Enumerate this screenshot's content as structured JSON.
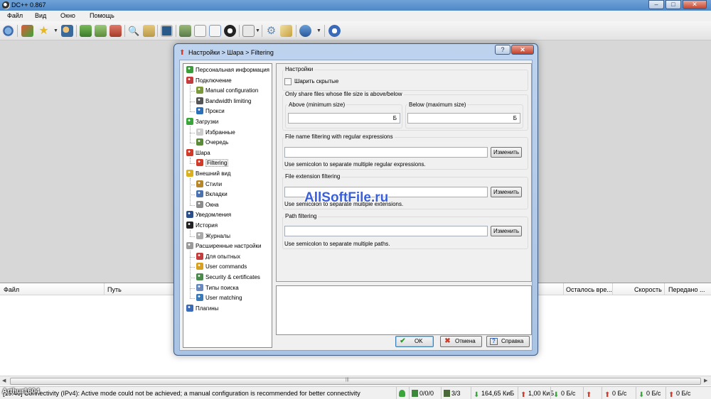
{
  "window": {
    "title": "DC++ 0.867",
    "controls": {
      "minimize": "–",
      "maximize": "□",
      "close": "✕"
    }
  },
  "menu": [
    "Файл",
    "Вид",
    "Окно",
    "Помощь"
  ],
  "toolbar": {
    "icons": [
      "connect-icon",
      "reconnect-icon",
      "favorites-icon",
      "favorite-users-icon",
      "download-queue-icon",
      "finished-downloads-icon",
      "upload-queue-icon",
      "search-icon",
      "adl-search-icon",
      "search-spy-icon",
      "open-filelist-icon",
      "notepad-icon",
      "network-stats-icon",
      "settings-icon",
      "plugins-icon",
      "refresh-share-icon",
      "help-icon"
    ]
  },
  "transfers": {
    "columns": [
      "Файл",
      "Путь",
      "Осталось вре...",
      "Скорость",
      "Передано ..."
    ]
  },
  "statusbar": {
    "message": "[19:46] Connectivity (IPv4): Active mode could not be achieved; a manual configuration is recommended for better connectivity",
    "watermark_text": "Arthur1604",
    "hubs": "0/0/0",
    "slots": "3/3",
    "downloaded": "164,65 КиБ",
    "uploaded": "1,00 КиБ",
    "down_speed": "0 Б/с",
    "up_speed": "0 Б/с",
    "down_limit": "0 Б/с",
    "up_limit": "0 Б/с"
  },
  "dialog": {
    "title": "Настройки > Шара > Filtering",
    "help_button": "?",
    "close_button": "✕",
    "tree": [
      {
        "label": "Персональная информация",
        "level": 0,
        "icon": "user-icon",
        "color": "#3a9d3a"
      },
      {
        "label": "Подключение",
        "level": 0,
        "icon": "antenna-icon",
        "color": "#c43c3c"
      },
      {
        "label": "Manual configuration",
        "level": 1,
        "icon": "manual-config-icon",
        "color": "#7a9a3a"
      },
      {
        "label": "Bandwidth limiting",
        "level": 1,
        "icon": "speedometer-icon",
        "color": "#555555"
      },
      {
        "label": "Прокси",
        "level": 1,
        "icon": "globe-icon",
        "color": "#2c6fb8"
      },
      {
        "label": "Загрузки",
        "level": 0,
        "icon": "download-arrow-icon",
        "color": "#3aa53a"
      },
      {
        "label": "Избранные",
        "level": 1,
        "icon": "favorites-folder-icon",
        "color": "#cccccc"
      },
      {
        "label": "Очередь",
        "level": 1,
        "icon": "queue-icon",
        "color": "#5a8a3a"
      },
      {
        "label": "Шара",
        "level": 0,
        "icon": "share-arrow-icon",
        "color": "#d23a2a"
      },
      {
        "label": "Filtering",
        "level": 1,
        "icon": "filter-arrow-icon",
        "color": "#d23a2a",
        "selected": true
      },
      {
        "label": "Внешний вид",
        "level": 0,
        "icon": "appearance-icon",
        "color": "#d8b020"
      },
      {
        "label": "Стили",
        "level": 1,
        "icon": "brush-icon",
        "color": "#b8862a"
      },
      {
        "label": "Вкладки",
        "level": 1,
        "icon": "tabs-icon",
        "color": "#4a72b0"
      },
      {
        "label": "Окна",
        "level": 1,
        "icon": "windows-icon",
        "color": "#8c8c8c"
      },
      {
        "label": "Уведомления",
        "level": 0,
        "icon": "notifications-icon",
        "color": "#2c4f8c"
      },
      {
        "label": "История",
        "level": 0,
        "icon": "history-icon",
        "color": "#222222"
      },
      {
        "label": "Журналы",
        "level": 1,
        "icon": "logs-icon",
        "color": "#aaaaaa"
      },
      {
        "label": "Расширенные настройки",
        "level": 0,
        "icon": "advanced-gear-icon",
        "color": "#9a9a9a"
      },
      {
        "label": "Для опытных",
        "level": 1,
        "icon": "tools-icon",
        "color": "#c43c3c"
      },
      {
        "label": "User commands",
        "level": 1,
        "icon": "user-commands-icon",
        "color": "#d8a020"
      },
      {
        "label": "Security & certificates",
        "level": 1,
        "icon": "security-icon",
        "color": "#4a8a4a"
      },
      {
        "label": "Типы поиска",
        "level": 1,
        "icon": "search-types-icon",
        "color": "#6a8abf"
      },
      {
        "label": "User matching",
        "level": 1,
        "icon": "user-matching-icon",
        "color": "#3a7ab8"
      },
      {
        "label": "Плагины",
        "level": 0,
        "icon": "plugins-icon",
        "color": "#3a6ab8"
      }
    ],
    "page": {
      "settings_group": "Настройки",
      "share_hidden_label": "Шарить скрытые",
      "share_hidden_checked": false,
      "size_group": "Only share files whose file size is above/below",
      "above_label": "Above (minimum size)",
      "above_value": "",
      "above_unit": "Б",
      "below_label": "Below (maximum size)",
      "below_value": "",
      "below_unit": "Б",
      "filename_group": "File name filtering with regular expressions",
      "filename_value": "",
      "filename_hint": "Use semicolon to separate multiple regular expressions.",
      "extension_group": "File extension filtering",
      "extension_value": "",
      "extension_hint": "Use semicolon to separate multiple extensions.",
      "path_group": "Path filtering",
      "path_value": "",
      "path_hint": "Use semicolon to separate multiple paths.",
      "change_button": "Изменить"
    },
    "buttons": {
      "ok": "OK",
      "cancel": "Отмена",
      "help": "Справка"
    }
  },
  "watermark": "AllSoftFile.ru"
}
